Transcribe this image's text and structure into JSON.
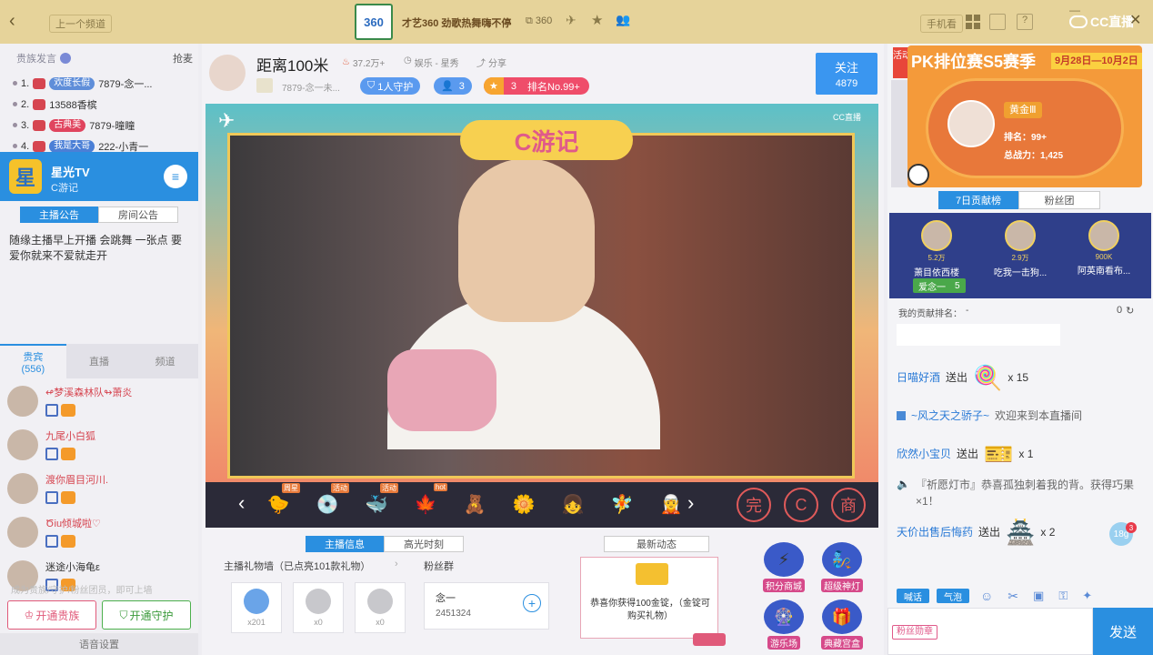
{
  "topbar": {
    "prev_label": "上一个频道",
    "channel_logo_text": "360",
    "title": "才艺360 劲歌热舞嗨不停",
    "room_id": "360",
    "handbook_label": "手机看",
    "brand": "CC直播"
  },
  "left": {
    "rank_header": "贵族发言",
    "grab_label": "抢麦",
    "rank_list": [
      {
        "n": "1.",
        "badge": "欢度长假",
        "badge_color": "#5f8ed9",
        "name": "7879-念一..."
      },
      {
        "n": "2.",
        "badge": "",
        "badge_color": "",
        "name": "13588香槟"
      },
      {
        "n": "3.",
        "badge": "古典美",
        "badge_color": "#e0445e",
        "name": "7879-曈瞳"
      },
      {
        "n": "4.",
        "badge": "我是大哥",
        "badge_color": "#4b7fd6",
        "name": "222-小青一"
      }
    ],
    "channel_card": {
      "name": "星光TV",
      "sub": "C游记",
      "logo": "星"
    },
    "notice_tabs": [
      "主播公告",
      "房间公告"
    ],
    "notice_text": "随缘主播早上开播 会跳舞 一张点 要爱你就来不爱就走开",
    "user_tabs": [
      {
        "label": "贵宾",
        "count": "(556)"
      },
      {
        "label": "直播",
        "count": ""
      },
      {
        "label": "频道",
        "count": ""
      }
    ],
    "users": [
      {
        "name": "↫梦溪森林队↬萧炎",
        "name_color": "#d64550"
      },
      {
        "name": "九尾小白狐",
        "name_color": "#d64550"
      },
      {
        "name": "渡你眉目河川.",
        "name_color": "#d64550"
      },
      {
        "name": "Ծiu倾城啦♡",
        "name_color": "#d64550"
      },
      {
        "name": "迷途小海龟ε",
        "name_color": "#333333"
      }
    ],
    "tip": "成为贵族/守护/粉丝团员，即可上墙",
    "open_noble": "开通贵族",
    "open_guard": "开通守护",
    "voice_settings": "语音设置"
  },
  "streamer": {
    "name": "距离100米",
    "heat": "37.2万+",
    "category": "娱乐 - 星秀",
    "share": "分享",
    "guild": "7879-念一未...",
    "guard": "1人守护",
    "fans": "3",
    "star": "3",
    "rank": "排名No.99+",
    "follow_label": "关注",
    "follow_count": "4879"
  },
  "video": {
    "show_title": "C游记",
    "watermark": "CC直播"
  },
  "giftbar": {
    "gifts": [
      {
        "icon": "🐤",
        "tag": "周星"
      },
      {
        "icon": "💿",
        "tag": "活动"
      },
      {
        "icon": "🐳",
        "tag": "活动"
      },
      {
        "icon": "🍁",
        "tag": "hot"
      },
      {
        "icon": "🧸",
        "tag": ""
      },
      {
        "icon": "🌼",
        "tag": ""
      },
      {
        "icon": "👧",
        "tag": ""
      },
      {
        "icon": "🧚",
        "tag": ""
      },
      {
        "icon": "🧝",
        "tag": ""
      }
    ],
    "extras": [
      "完",
      "C",
      "商"
    ]
  },
  "info": {
    "tabs": [
      "主播信息",
      "高光时刻"
    ],
    "gift_wall": "主播礼物墙（已点亮101款礼物）",
    "gift_counts": [
      "x201",
      "x0",
      "x0"
    ],
    "fan_group": "粉丝群",
    "fan_group_name": "念一",
    "fan_group_id": "2451324",
    "news_tab": "最新动态",
    "news_text": "恭喜你获得100金锭，（金锭可购买礼物）",
    "news_highlight": "100"
  },
  "apps": [
    {
      "label": "积分商城",
      "icon": "⚡"
    },
    {
      "label": "超级神灯",
      "icon": "🧞"
    },
    {
      "label": "游乐场",
      "icon": "🎡"
    },
    {
      "label": "典藏宫盒",
      "icon": "🎁"
    }
  ],
  "right": {
    "pk": {
      "title": "PK排位赛S5赛季",
      "dates": "9月28日—10月2日",
      "tier": "黄金Ⅲ",
      "rank": "排名：99+",
      "power": "总战力：1,425",
      "side_tab": "活动"
    },
    "contrib_tabs": [
      "7日贡献榜",
      "粉丝团"
    ],
    "top3": [
      {
        "name": "萧目依西楼",
        "score": "5.2万"
      },
      {
        "name": "吃我一击狗...",
        "score": "2.9万"
      },
      {
        "name": "阿英南看布...",
        "score": "900K"
      }
    ],
    "top_tag": "爱念一",
    "top_tag_num": "5",
    "my_rank_label": "我的贡献排名：",
    "my_rank_value": "-",
    "my_rank_num": "0",
    "chat": [
      {
        "type": "gift",
        "user": "日喵好酒",
        "action": "送出",
        "gift_icon": "🍭",
        "count": "x 15"
      },
      {
        "type": "welcome",
        "user": "~风之天之骄子~",
        "text": "欢迎来到本直播间"
      },
      {
        "type": "gift",
        "user": "欣然小宝贝",
        "action": "送出",
        "gift_icon": "🎫",
        "count": "x 1"
      },
      {
        "type": "system",
        "text": "『祈愿灯市』恭喜孤独刺着我的背。获得巧果×1！"
      },
      {
        "type": "gift",
        "user": "天价出售后悔药",
        "action": "送出",
        "gift_icon": "🏯",
        "count": "x 2"
      }
    ],
    "bubble_value": "18g",
    "bubble_badge": "3",
    "input_tabs": [
      "喊话",
      "气泡"
    ],
    "input_badge": "粉丝勋章",
    "send": "发送"
  }
}
